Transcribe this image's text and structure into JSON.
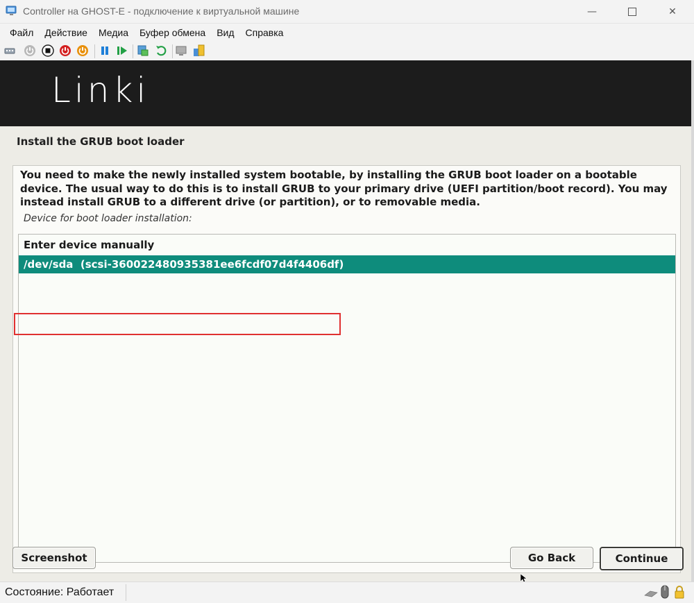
{
  "window": {
    "title": "Controller на GHOST-E - подключение к виртуальной машине",
    "controls": {
      "minimize": "minimize-icon",
      "maximize": "maximize-icon",
      "close": "close-icon"
    }
  },
  "menu": {
    "items": [
      "Файл",
      "Действие",
      "Медиа",
      "Буфер обмена",
      "Вид",
      "Справка"
    ]
  },
  "toolbar": {
    "icons": [
      "ctrl-alt-del-icon",
      "start-icon",
      "turn-off-icon",
      "shutdown-icon",
      "power-icon",
      "pause-icon",
      "resume-icon",
      "checkpoint-icon",
      "revert-icon",
      "enhanced-session-icon",
      "share-icon"
    ]
  },
  "guest": {
    "logo": "Linki",
    "step_title": "Install the GRUB boot loader",
    "description": "You need to make the newly installed system bootable, by installing the GRUB boot loader on a bootable device. The usual way to do this is to install GRUB to your primary drive (UEFI partition/boot record). You may instead install GRUB to a different drive (or partition), or to removable media.",
    "device_label": "Device for boot loader installation:",
    "devices": [
      {
        "label": "Enter device manually",
        "selected": false
      },
      {
        "label": "/dev/sda  (scsi-360022480935381ee6fcdf07d4f4406df)",
        "selected": true
      }
    ],
    "buttons": {
      "screenshot": "Screenshot",
      "go_back": "Go Back",
      "continue": "Continue"
    },
    "selection_color": "#0e8c7c"
  },
  "status": {
    "text": "Состояние: Работает"
  }
}
